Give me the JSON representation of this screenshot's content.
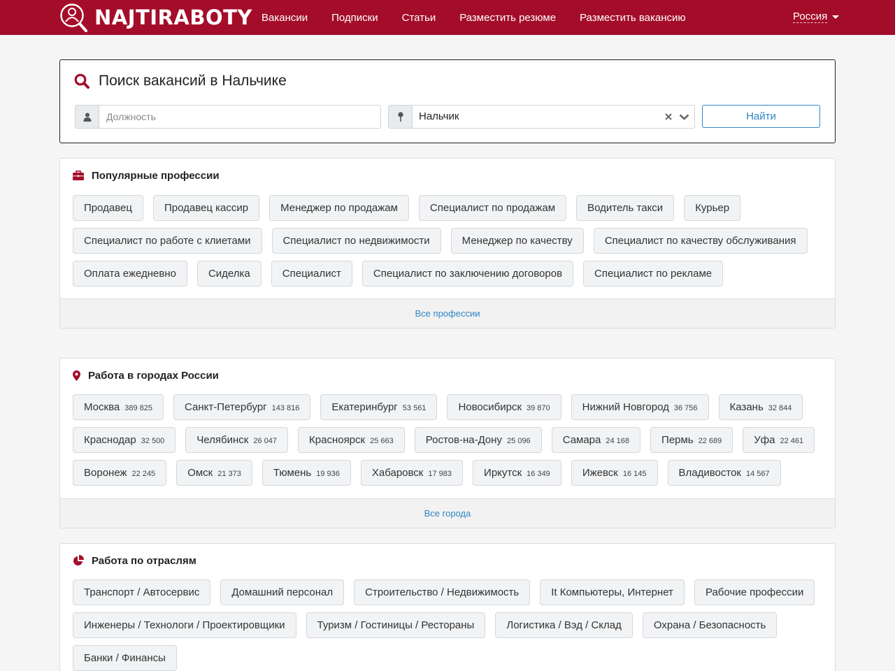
{
  "colors": {
    "brand": "#a40d2a",
    "link": "#2f86c4",
    "icon": "#a40d2a"
  },
  "header": {
    "logo_text": "NAJTIRABOTY",
    "nav": [
      "Вакансии",
      "Подписки",
      "Статьи",
      "Разместить резюме",
      "Разместить вакансию"
    ],
    "region": "Россия"
  },
  "search": {
    "title": "Поиск вакансий в Нальчике",
    "position_placeholder": "Должность",
    "city_value": "Нальчик",
    "submit_label": "Найти",
    "icons": [
      "search-icon",
      "user-icon",
      "map-pin-icon",
      "clear-icon",
      "chevron-down-icon"
    ]
  },
  "professions": {
    "title": "Популярные профессии",
    "icon": "briefcase-icon",
    "items": [
      "Продавец",
      "Продавец кассир",
      "Менеджер по продажам",
      "Специалист по продажам",
      "Водитель такси",
      "Курьер",
      "Специалист по работе с клиетами",
      "Специалист по недвижимости",
      "Менеджер по качеству",
      "Специалист по качеству обслуживания",
      "Оплата ежедневно",
      "Сиделка",
      "Специалист",
      "Специалист по заключению договоров",
      "Специалист по рекламе"
    ],
    "footer_link": "Все профессии"
  },
  "cities": {
    "title": "Работа в городах России",
    "icon": "map-marker-icon",
    "items": [
      {
        "name": "Москва",
        "count": "389 825"
      },
      {
        "name": "Санкт-Петербург",
        "count": "143 816"
      },
      {
        "name": "Екатеринбург",
        "count": "53 561"
      },
      {
        "name": "Новосибирск",
        "count": "39 870"
      },
      {
        "name": "Нижний Новгород",
        "count": "36 756"
      },
      {
        "name": "Казань",
        "count": "32 844"
      },
      {
        "name": "Краснодар",
        "count": "32 500"
      },
      {
        "name": "Челябинск",
        "count": "26 047"
      },
      {
        "name": "Красноярск",
        "count": "25 663"
      },
      {
        "name": "Ростов-на-Дону",
        "count": "25 096"
      },
      {
        "name": "Самара",
        "count": "24 168"
      },
      {
        "name": "Пермь",
        "count": "22 689"
      },
      {
        "name": "Уфа",
        "count": "22 461"
      },
      {
        "name": "Воронеж",
        "count": "22 245"
      },
      {
        "name": "Омск",
        "count": "21 373"
      },
      {
        "name": "Тюмень",
        "count": "19 936"
      },
      {
        "name": "Хабаровск",
        "count": "17 983"
      },
      {
        "name": "Иркутск",
        "count": "16 349"
      },
      {
        "name": "Ижевск",
        "count": "16 145"
      },
      {
        "name": "Владивосток",
        "count": "14 567"
      }
    ],
    "footer_link": "Все города"
  },
  "industries": {
    "title": "Работа по отраслям",
    "icon": "pie-chart-icon",
    "items": [
      "Транспорт / Автосервис",
      "Домашний персонал",
      "Строительство / Недвижимость",
      "It Компьютеры, Интернет",
      "Рабочие профессии",
      "Инженеры / Технологи / Проектировщики",
      "Туризм / Гостиницы / Рестораны",
      "Логистика / Вэд / Склад",
      "Охрана / Безопасность",
      "Банки / Финансы"
    ]
  }
}
